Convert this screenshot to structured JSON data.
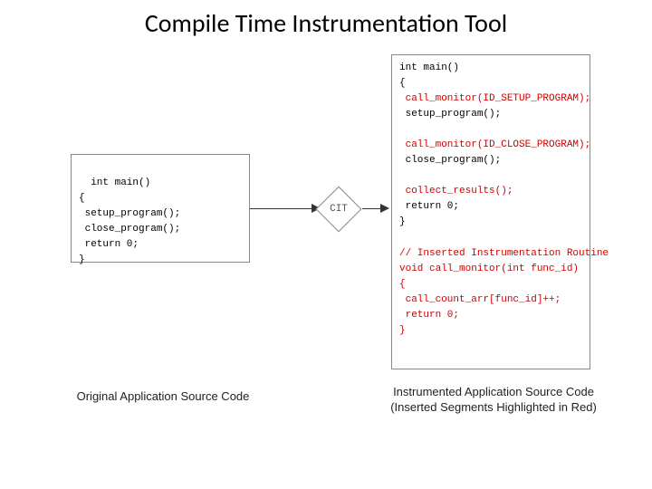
{
  "title": "Compile Time Instrumentation Tool",
  "left_code": "int main()\n{\n setup_program();\n close_program();\n return 0;\n}",
  "cit_label": "CIT",
  "right_code_seg1": "int main()\n{",
  "right_code_seg2": " call_monitor(ID_SETUP_PROGRAM);",
  "right_code_seg3": " setup_program();\n",
  "right_code_seg4": " call_monitor(ID_CLOSE_PROGRAM);",
  "right_code_seg5": " close_program();\n",
  "right_code_seg6": " collect_results();",
  "right_code_seg7": " return 0;\n}\n",
  "right_code_seg8": "// Inserted Instrumentation Routine\nvoid call_monitor(int func_id)\n{\n call_count_arr[func_id]++;\n return 0;\n}",
  "caption_left": "Original Application Source Code",
  "caption_right_l1": "Instrumented Application Source Code",
  "caption_right_l2": "(Inserted Segments Highlighted in Red)",
  "chart_data": {
    "type": "diagram",
    "nodes": [
      {
        "id": "original",
        "label": "Original Application Source Code",
        "kind": "code-box"
      },
      {
        "id": "cit",
        "label": "CIT",
        "kind": "decision-diamond"
      },
      {
        "id": "instrumented",
        "label": "Instrumented Application Source Code (Inserted Segments Highlighted in Red)",
        "kind": "code-box"
      }
    ],
    "edges": [
      {
        "from": "original",
        "to": "cit"
      },
      {
        "from": "cit",
        "to": "instrumented"
      }
    ]
  }
}
